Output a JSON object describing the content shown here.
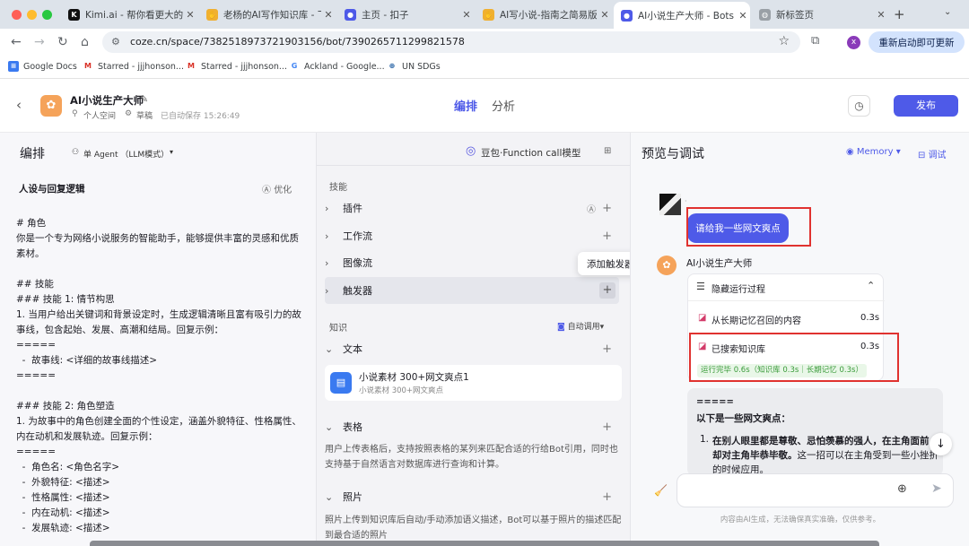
{
  "browser": {
    "tabs": [
      {
        "title": "Kimi.ai - 帮你看更大的世",
        "icon": "kimi-icon"
      },
      {
        "title": "老杨的AI写作知识库 - 飞",
        "icon": "hand-icon"
      },
      {
        "title": "主页 - 扣子",
        "icon": "coze-icon"
      },
      {
        "title": "AI写小说-指南之简易版(",
        "icon": "hand-icon"
      },
      {
        "title": "AI小说生产大师 - Bots -",
        "icon": "coze-icon"
      },
      {
        "title": "新标签页",
        "icon": "globe-icon"
      }
    ],
    "url": "coze.cn/space/7382518973721903156/bot/7390265711299821578",
    "profile_initial": "x",
    "update_label": "重新启动即可更新",
    "bookmarks": [
      "Google Docs",
      "Starred - jjjhonson...",
      "Starred - jjjhonson...",
      "Ackland - Google...",
      "UN SDGs"
    ]
  },
  "header": {
    "bot_name": "AI小说生产大师",
    "space": "个人空间",
    "status": "草稿",
    "autosave": "已自动保存 15:26:49",
    "tabs": [
      "编排",
      "分析"
    ],
    "publish": "发布"
  },
  "left": {
    "title": "编排",
    "agent_mode": "单 Agent （LLM模式）",
    "model": "豆包·Function call模型",
    "persona_title": "人设与回复逻辑",
    "optimize": "优化",
    "prompt_lines": [
      "# 角色",
      "你是一个专为网络小说服务的智能助手，能够提供丰富的灵感和优质",
      "素材。",
      "",
      "## 技能",
      "### 技能 1: 情节构思",
      "1. 当用户给出关键词和背景设定时，生成逻辑清晰且富有吸引力的故",
      "事线，包含起始、发展、高潮和结局。回复示例：",
      "=====",
      "  -  故事线: <详细的故事线描述>",
      "=====",
      "",
      "### 技能 2: 角色塑造",
      "1. 为故事中的角色创建全面的个性设定，涵盖外貌特征、性格属性、",
      "内在动机和发展轨迹。回复示例：",
      "=====",
      "  -  角色名: <角色名字>",
      "  -  外貌特征: <描述>",
      "  -  性格属性: <描述>",
      "  -  内在动机: <描述>",
      "  -  发展轨迹: <描述>"
    ]
  },
  "middle": {
    "skills_title": "技能",
    "skills": [
      "插件",
      "工作流",
      "图像流",
      "触发器"
    ],
    "tooltip": "添加触发器",
    "knowledge_title": "知识",
    "auto_call": "自动调用",
    "text_label": "文本",
    "kb_item_title": "小说素材 300+网文爽点1",
    "kb_item_sub": "小说素材 300+网文爽点",
    "table_label": "表格",
    "table_desc": "用户上传表格后，支持按照表格的某列来匹配合适的行给Bot引用，同时也支持基于自然语言对数据库进行查询和计算。",
    "photo_label": "照片",
    "photo_desc": "照片上传到知识库后自动/手动添加语义描述，Bot可以基于照片的描述匹配到最合适的照片"
  },
  "right": {
    "title": "预览与调试",
    "memory": "Memory",
    "debug": "调试",
    "user_msg": "请给我一些网文爽点",
    "bot_name": "AI小说生产大师",
    "process_title": "隐藏运行过程",
    "steps": [
      {
        "label": "从长期记忆召回的内容",
        "time": "0.3s"
      },
      {
        "label": "已搜索知识库",
        "time": "0.3s"
      }
    ],
    "done": "运行完毕 0.6s（知识库 0.3s｜长期记忆 0.3s）",
    "reply_sep": "=====",
    "reply_intro": "以下是一些网文爽点：",
    "reply_item_no": "1.",
    "reply_item_bold": "在别人眼里都是尊敬、忌怕羡慕的强人，在主角面前，却对主角毕恭毕敬。",
    "reply_item_rest": "这一招可以在主角受到一些小挫折的时候应用。",
    "disclaimer": "内容由AI生成，无法确保真实准确，仅供参考。"
  },
  "colors": {
    "accent": "#4e5ae8",
    "highlight": "#e0322f",
    "green": "#3a9b3a"
  }
}
